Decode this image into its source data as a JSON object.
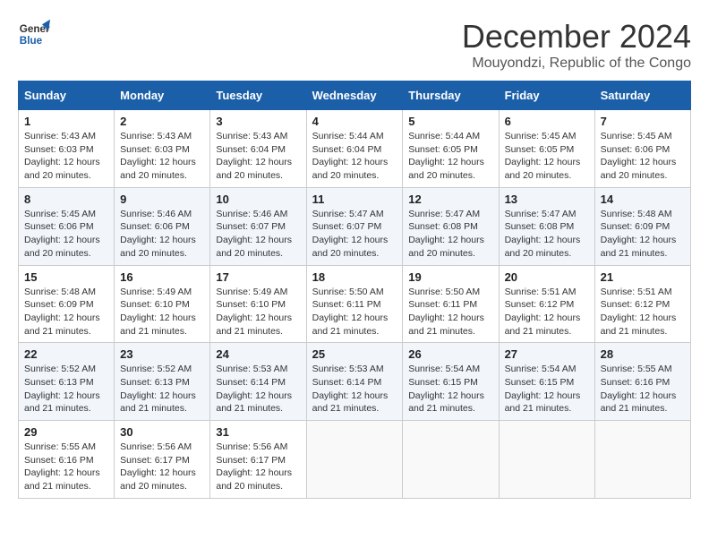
{
  "logo": {
    "line1": "General",
    "line2": "Blue"
  },
  "title": "December 2024",
  "location": "Mouyondzi, Republic of the Congo",
  "days_of_week": [
    "Sunday",
    "Monday",
    "Tuesday",
    "Wednesday",
    "Thursday",
    "Friday",
    "Saturday"
  ],
  "weeks": [
    [
      {
        "day": "1",
        "detail": "Sunrise: 5:43 AM\nSunset: 6:03 PM\nDaylight: 12 hours\nand 20 minutes."
      },
      {
        "day": "2",
        "detail": "Sunrise: 5:43 AM\nSunset: 6:03 PM\nDaylight: 12 hours\nand 20 minutes."
      },
      {
        "day": "3",
        "detail": "Sunrise: 5:43 AM\nSunset: 6:04 PM\nDaylight: 12 hours\nand 20 minutes."
      },
      {
        "day": "4",
        "detail": "Sunrise: 5:44 AM\nSunset: 6:04 PM\nDaylight: 12 hours\nand 20 minutes."
      },
      {
        "day": "5",
        "detail": "Sunrise: 5:44 AM\nSunset: 6:05 PM\nDaylight: 12 hours\nand 20 minutes."
      },
      {
        "day": "6",
        "detail": "Sunrise: 5:45 AM\nSunset: 6:05 PM\nDaylight: 12 hours\nand 20 minutes."
      },
      {
        "day": "7",
        "detail": "Sunrise: 5:45 AM\nSunset: 6:06 PM\nDaylight: 12 hours\nand 20 minutes."
      }
    ],
    [
      {
        "day": "8",
        "detail": "Sunrise: 5:45 AM\nSunset: 6:06 PM\nDaylight: 12 hours\nand 20 minutes."
      },
      {
        "day": "9",
        "detail": "Sunrise: 5:46 AM\nSunset: 6:06 PM\nDaylight: 12 hours\nand 20 minutes."
      },
      {
        "day": "10",
        "detail": "Sunrise: 5:46 AM\nSunset: 6:07 PM\nDaylight: 12 hours\nand 20 minutes."
      },
      {
        "day": "11",
        "detail": "Sunrise: 5:47 AM\nSunset: 6:07 PM\nDaylight: 12 hours\nand 20 minutes."
      },
      {
        "day": "12",
        "detail": "Sunrise: 5:47 AM\nSunset: 6:08 PM\nDaylight: 12 hours\nand 20 minutes."
      },
      {
        "day": "13",
        "detail": "Sunrise: 5:47 AM\nSunset: 6:08 PM\nDaylight: 12 hours\nand 20 minutes."
      },
      {
        "day": "14",
        "detail": "Sunrise: 5:48 AM\nSunset: 6:09 PM\nDaylight: 12 hours\nand 21 minutes."
      }
    ],
    [
      {
        "day": "15",
        "detail": "Sunrise: 5:48 AM\nSunset: 6:09 PM\nDaylight: 12 hours\nand 21 minutes."
      },
      {
        "day": "16",
        "detail": "Sunrise: 5:49 AM\nSunset: 6:10 PM\nDaylight: 12 hours\nand 21 minutes."
      },
      {
        "day": "17",
        "detail": "Sunrise: 5:49 AM\nSunset: 6:10 PM\nDaylight: 12 hours\nand 21 minutes."
      },
      {
        "day": "18",
        "detail": "Sunrise: 5:50 AM\nSunset: 6:11 PM\nDaylight: 12 hours\nand 21 minutes."
      },
      {
        "day": "19",
        "detail": "Sunrise: 5:50 AM\nSunset: 6:11 PM\nDaylight: 12 hours\nand 21 minutes."
      },
      {
        "day": "20",
        "detail": "Sunrise: 5:51 AM\nSunset: 6:12 PM\nDaylight: 12 hours\nand 21 minutes."
      },
      {
        "day": "21",
        "detail": "Sunrise: 5:51 AM\nSunset: 6:12 PM\nDaylight: 12 hours\nand 21 minutes."
      }
    ],
    [
      {
        "day": "22",
        "detail": "Sunrise: 5:52 AM\nSunset: 6:13 PM\nDaylight: 12 hours\nand 21 minutes."
      },
      {
        "day": "23",
        "detail": "Sunrise: 5:52 AM\nSunset: 6:13 PM\nDaylight: 12 hours\nand 21 minutes."
      },
      {
        "day": "24",
        "detail": "Sunrise: 5:53 AM\nSunset: 6:14 PM\nDaylight: 12 hours\nand 21 minutes."
      },
      {
        "day": "25",
        "detail": "Sunrise: 5:53 AM\nSunset: 6:14 PM\nDaylight: 12 hours\nand 21 minutes."
      },
      {
        "day": "26",
        "detail": "Sunrise: 5:54 AM\nSunset: 6:15 PM\nDaylight: 12 hours\nand 21 minutes."
      },
      {
        "day": "27",
        "detail": "Sunrise: 5:54 AM\nSunset: 6:15 PM\nDaylight: 12 hours\nand 21 minutes."
      },
      {
        "day": "28",
        "detail": "Sunrise: 5:55 AM\nSunset: 6:16 PM\nDaylight: 12 hours\nand 21 minutes."
      }
    ],
    [
      {
        "day": "29",
        "detail": "Sunrise: 5:55 AM\nSunset: 6:16 PM\nDaylight: 12 hours\nand 21 minutes."
      },
      {
        "day": "30",
        "detail": "Sunrise: 5:56 AM\nSunset: 6:17 PM\nDaylight: 12 hours\nand 20 minutes."
      },
      {
        "day": "31",
        "detail": "Sunrise: 5:56 AM\nSunset: 6:17 PM\nDaylight: 12 hours\nand 20 minutes."
      },
      {
        "day": "",
        "detail": ""
      },
      {
        "day": "",
        "detail": ""
      },
      {
        "day": "",
        "detail": ""
      },
      {
        "day": "",
        "detail": ""
      }
    ]
  ]
}
